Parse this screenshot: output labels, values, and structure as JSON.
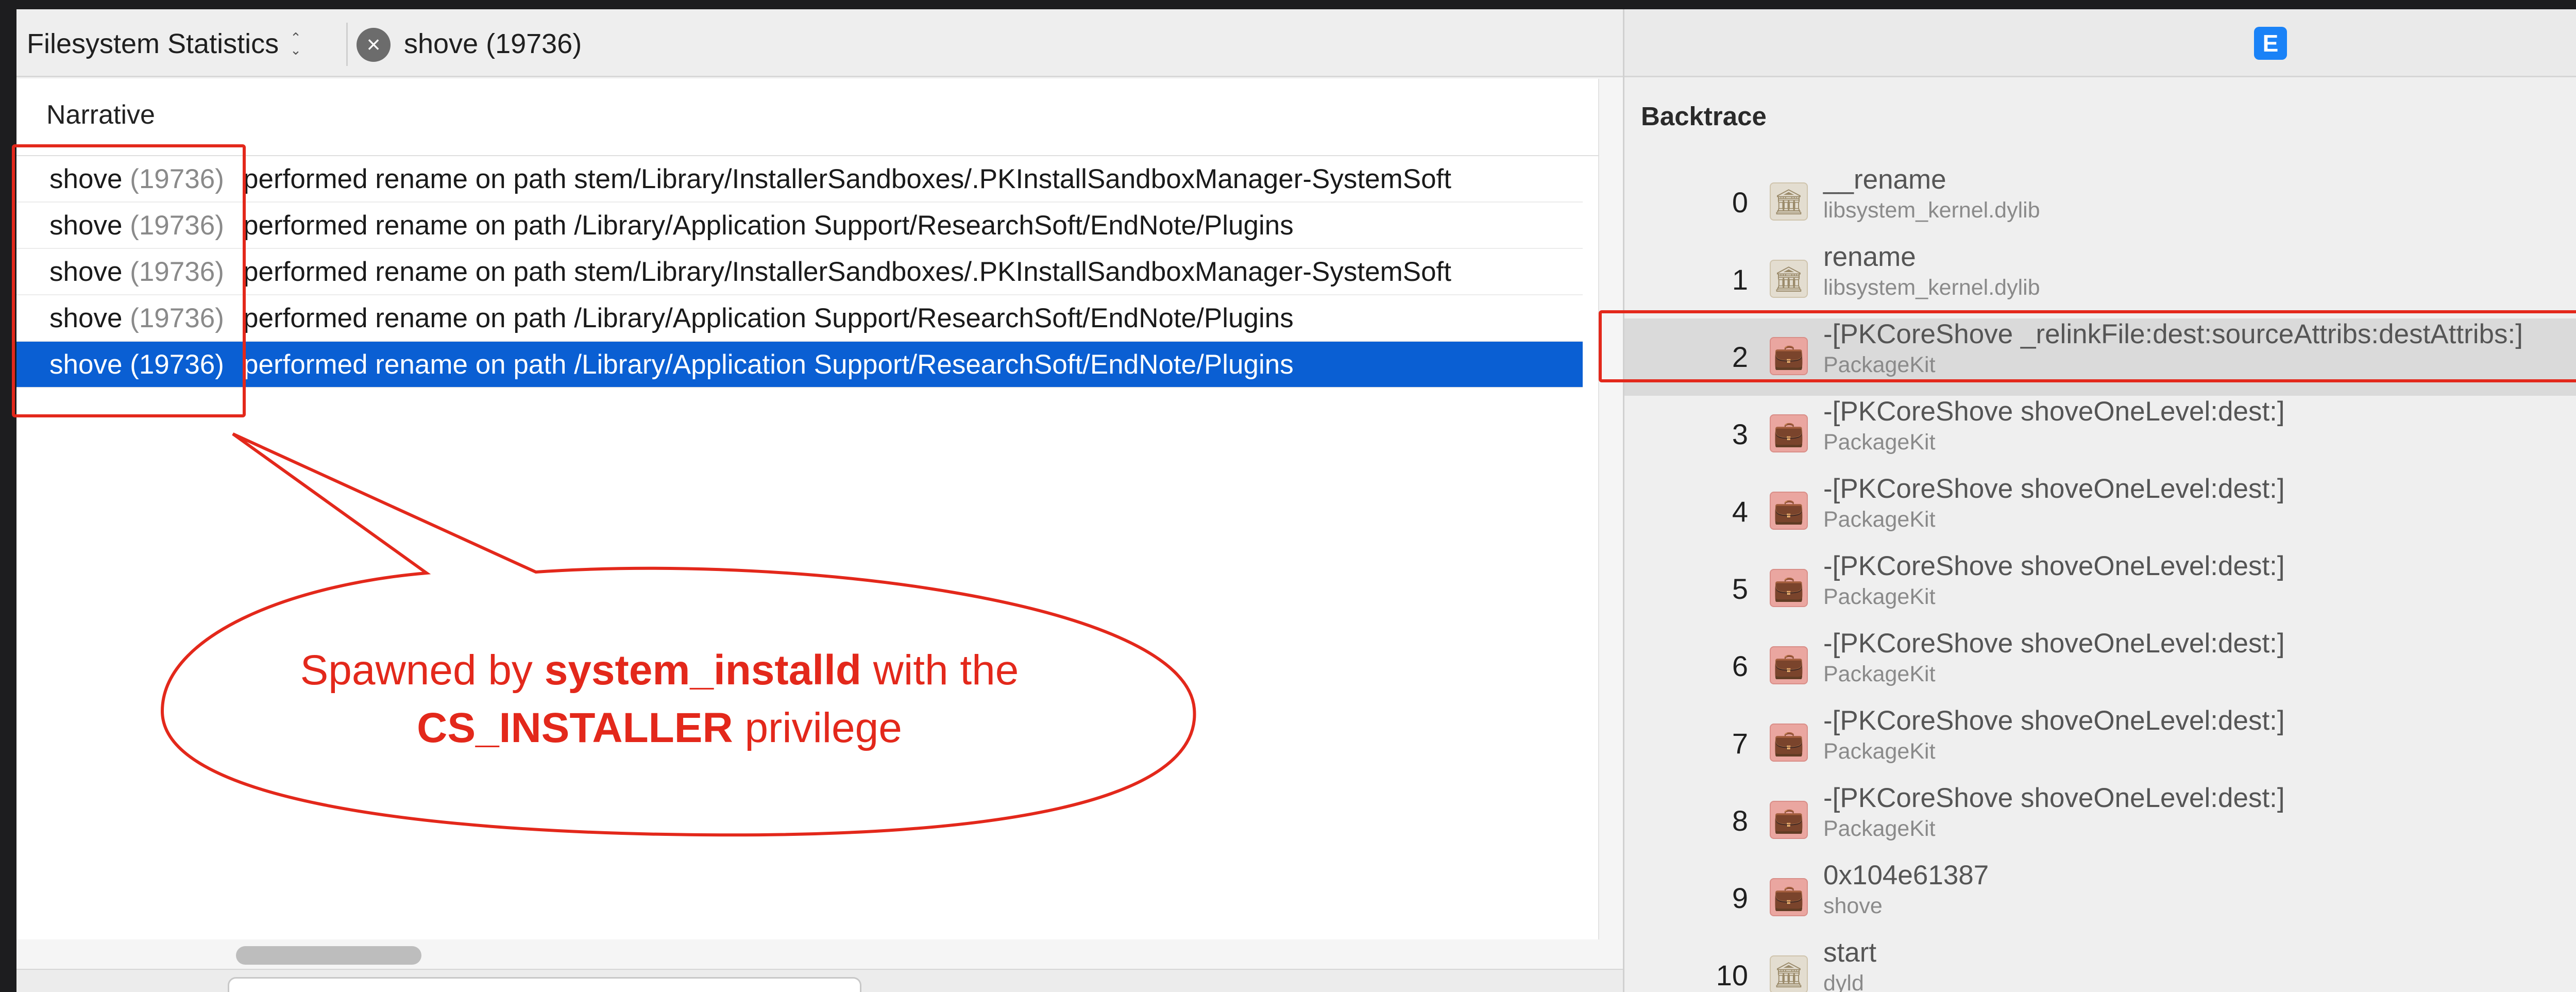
{
  "toolbar": {
    "instrument": "Filesystem Statistics",
    "process_filter": "shove (19736)"
  },
  "narrative": {
    "column_header": "Narrative",
    "rows": [
      {
        "process": "shove",
        "pid": "(19736)",
        "text": "performed rename on path stem/Library/InstallerSandboxes/.PKInstallSandboxManager-SystemSoft",
        "selected": false
      },
      {
        "process": "shove",
        "pid": "(19736)",
        "text": "performed rename on path /Library/Application Support/ResearchSoft/EndNote/Plugins",
        "selected": false
      },
      {
        "process": "shove",
        "pid": "(19736)",
        "text": "performed rename on path stem/Library/InstallerSandboxes/.PKInstallSandboxManager-SystemSoft",
        "selected": false
      },
      {
        "process": "shove",
        "pid": "(19736)",
        "text": "performed rename on path /Library/Application Support/ResearchSoft/EndNote/Plugins",
        "selected": false
      },
      {
        "process": "shove",
        "pid": "(19736)",
        "text": "performed rename on path /Library/Application Support/ResearchSoft/EndNote/Plugins",
        "selected": true
      }
    ]
  },
  "extended_detail": {
    "badge": "E",
    "title": "Backtrace",
    "frames": [
      {
        "index": "0",
        "symbol": "__rename",
        "library": "libsystem_kernel.dylib",
        "icon": "library-icon"
      },
      {
        "index": "1",
        "symbol": "rename",
        "library": "libsystem_kernel.dylib",
        "icon": "library-icon"
      },
      {
        "index": "2",
        "symbol": "-[PKCoreShove _relinkFile:dest:sourceAttribs:destAttribs:]",
        "library": "PackageKit",
        "icon": "app-icon",
        "selected": true
      },
      {
        "index": "3",
        "symbol": "-[PKCoreShove shoveOneLevel:dest:]",
        "library": "PackageKit",
        "icon": "app-icon"
      },
      {
        "index": "4",
        "symbol": "-[PKCoreShove shoveOneLevel:dest:]",
        "library": "PackageKit",
        "icon": "app-icon"
      },
      {
        "index": "5",
        "symbol": "-[PKCoreShove shoveOneLevel:dest:]",
        "library": "PackageKit",
        "icon": "app-icon"
      },
      {
        "index": "6",
        "symbol": "-[PKCoreShove shoveOneLevel:dest:]",
        "library": "PackageKit",
        "icon": "app-icon"
      },
      {
        "index": "7",
        "symbol": "-[PKCoreShove shoveOneLevel:dest:]",
        "library": "PackageKit",
        "icon": "app-icon"
      },
      {
        "index": "8",
        "symbol": "-[PKCoreShove shoveOneLevel:dest:]",
        "library": "PackageKit",
        "icon": "app-icon"
      },
      {
        "index": "9",
        "symbol": "0x104e61387",
        "library": "shove",
        "icon": "app-icon"
      },
      {
        "index": "10",
        "symbol": "start",
        "library": "dyld",
        "icon": "library-icon"
      }
    ]
  },
  "annotation": {
    "line1_pre": "Spawned by ",
    "line1_bold": "system_installd",
    "line1_post": " with the",
    "line2_bold": "CS_INSTALLER",
    "line2_post": " privilege",
    "color": "#e3281b"
  }
}
